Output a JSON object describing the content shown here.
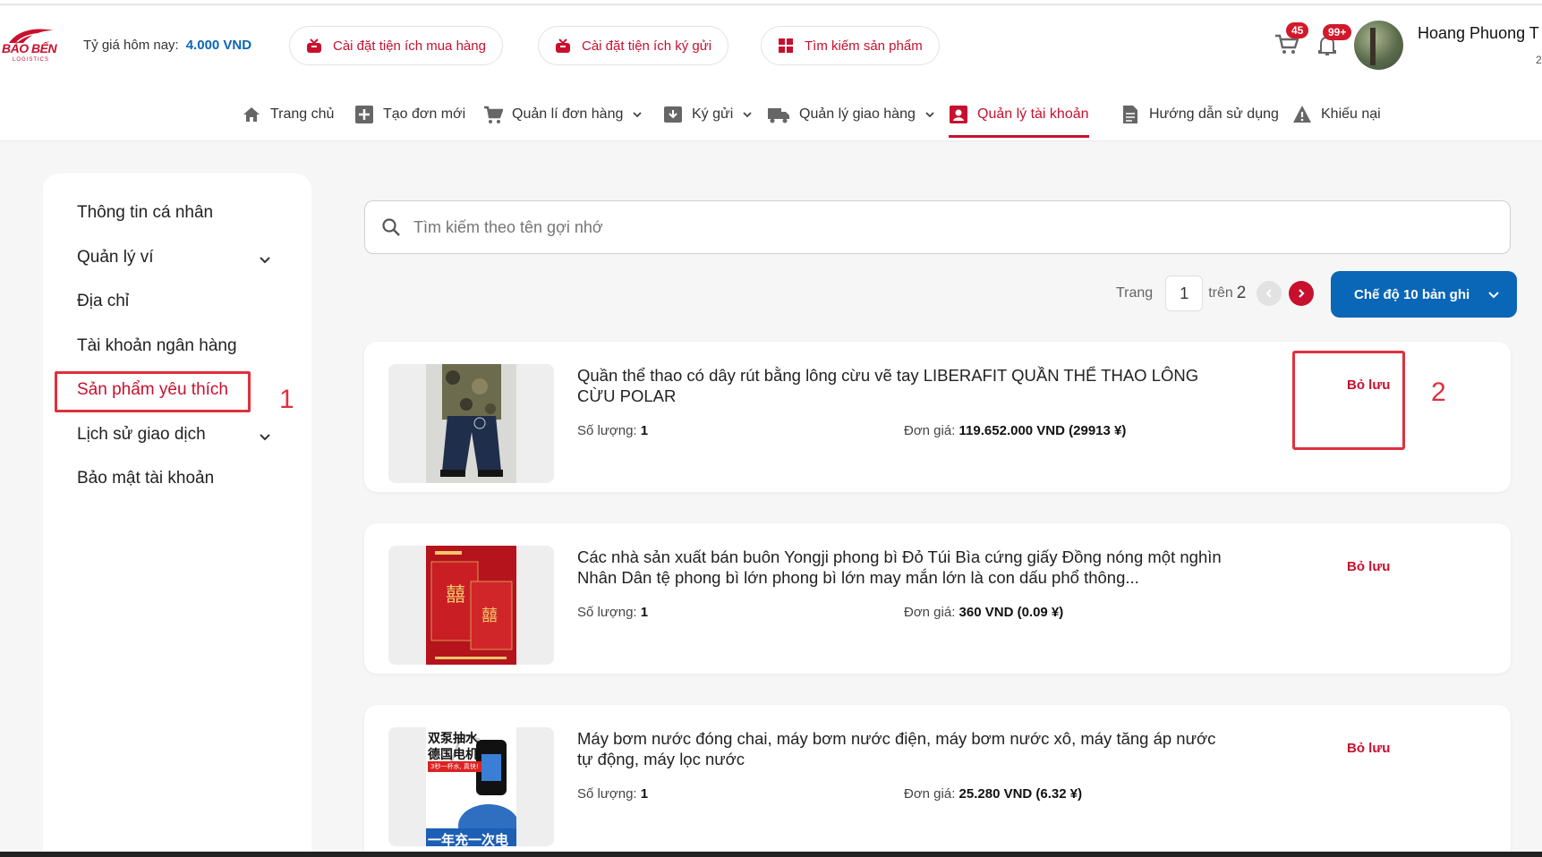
{
  "header": {
    "logo_text": "BẢO BẾN",
    "logo_sub": "LOGISTICS",
    "rate_label": "Tỷ giá hôm nay:",
    "rate_value": "4.000 VND",
    "pills": [
      {
        "label": "Cài đặt tiện ích mua hàng",
        "icon": "gift-icon"
      },
      {
        "label": "Cài đặt tiện ích ký gửi",
        "icon": "gift-icon"
      },
      {
        "label": "Tìm kiếm sản phẩm",
        "icon": "grid-icon"
      }
    ],
    "cart_badge": "45",
    "bell_badge": "99+",
    "user_name": "Hoang Phuong T",
    "user_sub": "2"
  },
  "nav": [
    {
      "label": "Trang chủ",
      "icon": "home-icon",
      "dropdown": false,
      "active": false
    },
    {
      "label": "Tạo đơn mới",
      "icon": "plus-box-icon",
      "dropdown": false,
      "active": false
    },
    {
      "label": "Quản lí đơn hàng",
      "icon": "cart-icon",
      "dropdown": true,
      "active": false
    },
    {
      "label": "Ký gửi",
      "icon": "box-in-icon",
      "dropdown": true,
      "active": false
    },
    {
      "label": "Quản lý giao hàng",
      "icon": "truck-icon",
      "dropdown": true,
      "active": false
    },
    {
      "label": "Quản lý tài khoản",
      "icon": "account-box-icon",
      "dropdown": false,
      "active": true
    },
    {
      "label": "Hướng dẫn sử dụng",
      "icon": "document-icon",
      "dropdown": false,
      "active": false
    },
    {
      "label": "Khiếu nại",
      "icon": "warning-icon",
      "dropdown": false,
      "active": false
    }
  ],
  "sidebar": {
    "items": [
      {
        "label": "Thông tin cá nhân",
        "dropdown": false
      },
      {
        "label": "Quản lý ví",
        "dropdown": true
      },
      {
        "label": "Địa chỉ",
        "dropdown": false
      },
      {
        "label": "Tài khoản ngân hàng",
        "dropdown": false
      },
      {
        "label": "Sản phẩm yêu thích",
        "dropdown": false
      },
      {
        "label": "Lịch sử giao dịch",
        "dropdown": true
      },
      {
        "label": "Bảo mật tài khoản",
        "dropdown": false
      }
    ],
    "annotation": "1"
  },
  "main": {
    "search_placeholder": "Tìm kiếm theo tên gợi nhớ",
    "pager": {
      "page_label": "Trang",
      "current": "1",
      "of_label": "trên",
      "total": "2"
    },
    "mode_label": "Chế độ 10 bản ghi",
    "annotation": "2",
    "qty_label": "Số lượng:",
    "price_label": "Đơn giá:",
    "unsave_label": "Bỏ lưu",
    "products": [
      {
        "title": "Quần thể thao có dây rút bằng lông cừu vẽ tay LIBERAFIT QUẦN THỂ THAO LÔNG CỪU POLAR",
        "qty": "1",
        "price": "119.652.000 VND (29913 ¥)"
      },
      {
        "title": "Các nhà sản xuất bán buôn Yongji phong bì Đỏ Túi Bìa cứng giấy Đồng nóng một nghìn Nhân Dân tệ phong bì lớn phong bì lớn may mắn lớn là con dấu phổ thông...",
        "qty": "1",
        "price": "360 VND (0.09 ¥)"
      },
      {
        "title": "Máy bơm nước đóng chai, máy bơm nước điện, máy bơm nước xô, máy tăng áp nước tự động, máy lọc nước",
        "qty": "1",
        "price": "25.280 VND (6.32 ¥)",
        "image_text_1": "双泵抽水",
        "image_text_2": "德国电机",
        "image_text_3": "3秒一杯水, 真快!",
        "image_text_4": "一年充一次电"
      }
    ]
  },
  "colors": {
    "brand_red": "#c8102e",
    "accent_blue": "#0a66b7",
    "annotation_red": "#e0303e"
  }
}
